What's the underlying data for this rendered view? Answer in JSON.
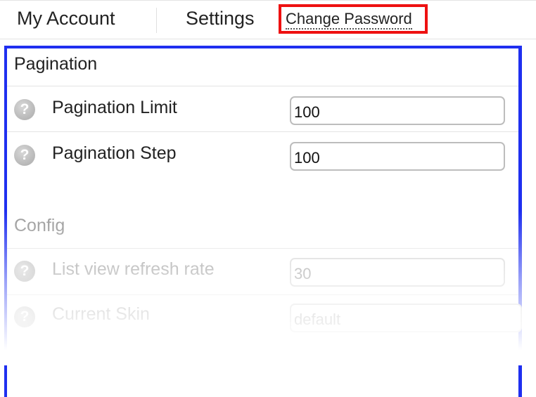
{
  "tabs": {
    "my_account": "My Account",
    "settings": "Settings",
    "change_password": "Change Password"
  },
  "pagination": {
    "title": "Pagination",
    "rows": [
      {
        "label": "Pagination Limit",
        "value": "100"
      },
      {
        "label": "Pagination Step",
        "value": "100"
      }
    ]
  },
  "config": {
    "title": "Config",
    "rows": [
      {
        "label": "List view refresh rate",
        "value": "30"
      },
      {
        "label": "Current Skin",
        "value": "default"
      }
    ]
  },
  "icons": {
    "help": "?"
  },
  "colors": {
    "highlight_red": "#ee1111",
    "highlight_blue": "#1f2ff0"
  }
}
